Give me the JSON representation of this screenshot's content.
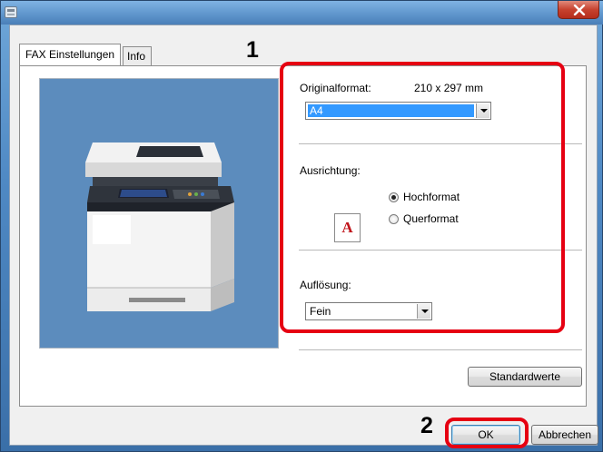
{
  "window": {
    "close_icon": "close-icon",
    "app_icon": "printer-icon"
  },
  "tabs": [
    {
      "label": "FAX Einstellungen",
      "active": true
    },
    {
      "label": "Info",
      "active": false
    }
  ],
  "preview": {
    "image": "multifunction-printer",
    "background": "#5c8cbd"
  },
  "settings": {
    "original_format_label": "Originalformat:",
    "original_format_size": "210 x 297 mm",
    "original_format_value": "A4",
    "orientation_label": "Ausrichtung:",
    "orientation_icon_letter": "A",
    "orientation_options": [
      {
        "label": "Hochformat",
        "checked": true
      },
      {
        "label": "Querformat",
        "checked": false
      }
    ],
    "resolution_label": "Auflösung:",
    "resolution_value": "Fein"
  },
  "buttons": {
    "defaults": "Standardwerte",
    "ok": "OK",
    "cancel": "Abbrechen"
  },
  "annotations": {
    "step1": "1",
    "step2": "2",
    "color": "#e60012"
  }
}
